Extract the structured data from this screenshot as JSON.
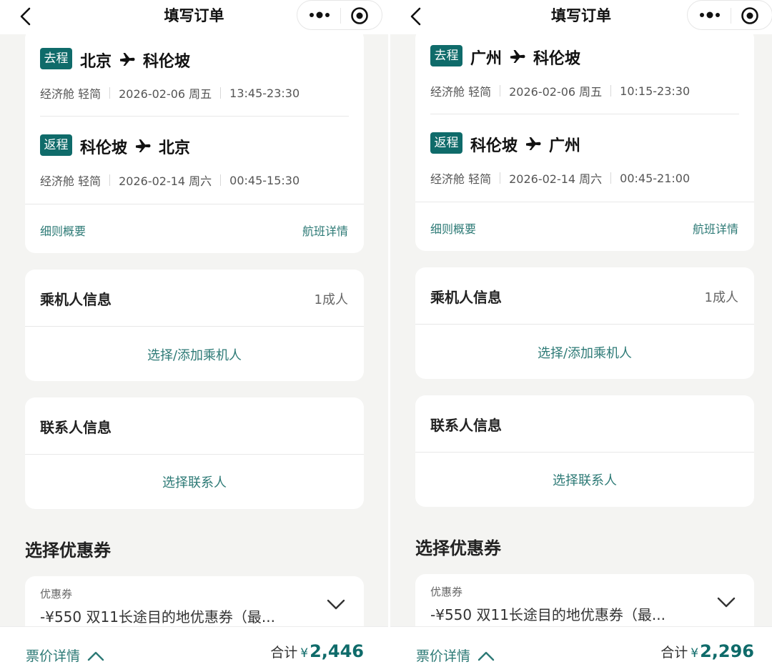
{
  "panels": [
    {
      "nav_title": "填写订单",
      "outbound": {
        "tag": "去程",
        "from": "北京",
        "to": "科伦坡",
        "cabin": "经济舱 轻简",
        "date": "2026-02-06 周五",
        "time": "13:45-23:30"
      },
      "return": {
        "tag": "返程",
        "from": "科伦坡",
        "to": "北京",
        "cabin": "经济舱 轻简",
        "date": "2026-02-14 周六",
        "time": "00:45-15:30"
      },
      "rules_link": "细则概要",
      "flight_detail_link": "航班详情",
      "passenger": {
        "title": "乘机人信息",
        "count": "1成人",
        "action": "选择/添加乘机人"
      },
      "contact": {
        "title": "联系人信息",
        "action": "选择联系人"
      },
      "coupon_section": "选择优惠券",
      "coupon": {
        "label": "优惠券",
        "value": "-¥550 双11长途目的地优惠券（最..."
      },
      "bottom": {
        "fee_detail": "票价详情",
        "total_label": "合计",
        "currency": "¥",
        "total_amount": "2,446"
      }
    },
    {
      "nav_title": "填写订单",
      "outbound": {
        "tag": "去程",
        "from": "广州",
        "to": "科伦坡",
        "cabin": "经济舱 轻简",
        "date": "2026-02-06 周五",
        "time": "10:15-23:30"
      },
      "return": {
        "tag": "返程",
        "from": "科伦坡",
        "to": "广州",
        "cabin": "经济舱 轻简",
        "date": "2026-02-14 周六",
        "time": "00:45-21:00"
      },
      "rules_link": "细则概要",
      "flight_detail_link": "航班详情",
      "passenger": {
        "title": "乘机人信息",
        "count": "1成人",
        "action": "选择/添加乘机人"
      },
      "contact": {
        "title": "联系人信息",
        "action": "选择联系人"
      },
      "coupon_section": "选择优惠券",
      "coupon": {
        "label": "优惠券",
        "value": "-¥550 双11长途目的地优惠券（最..."
      },
      "bottom": {
        "fee_detail": "票价详情",
        "total_label": "合计",
        "currency": "¥",
        "total_amount": "2,296"
      }
    }
  ],
  "icons": {
    "back": "chevron-left-icon",
    "more": "more-dots-icon",
    "close": "target-circle-icon",
    "plane": "airplane-icon",
    "dropdown": "chevron-down-icon",
    "expand": "chevron-up-icon"
  },
  "colors": {
    "accent": "#0f6b6a",
    "link": "#2d7a76",
    "background": "#f4f4f2"
  }
}
